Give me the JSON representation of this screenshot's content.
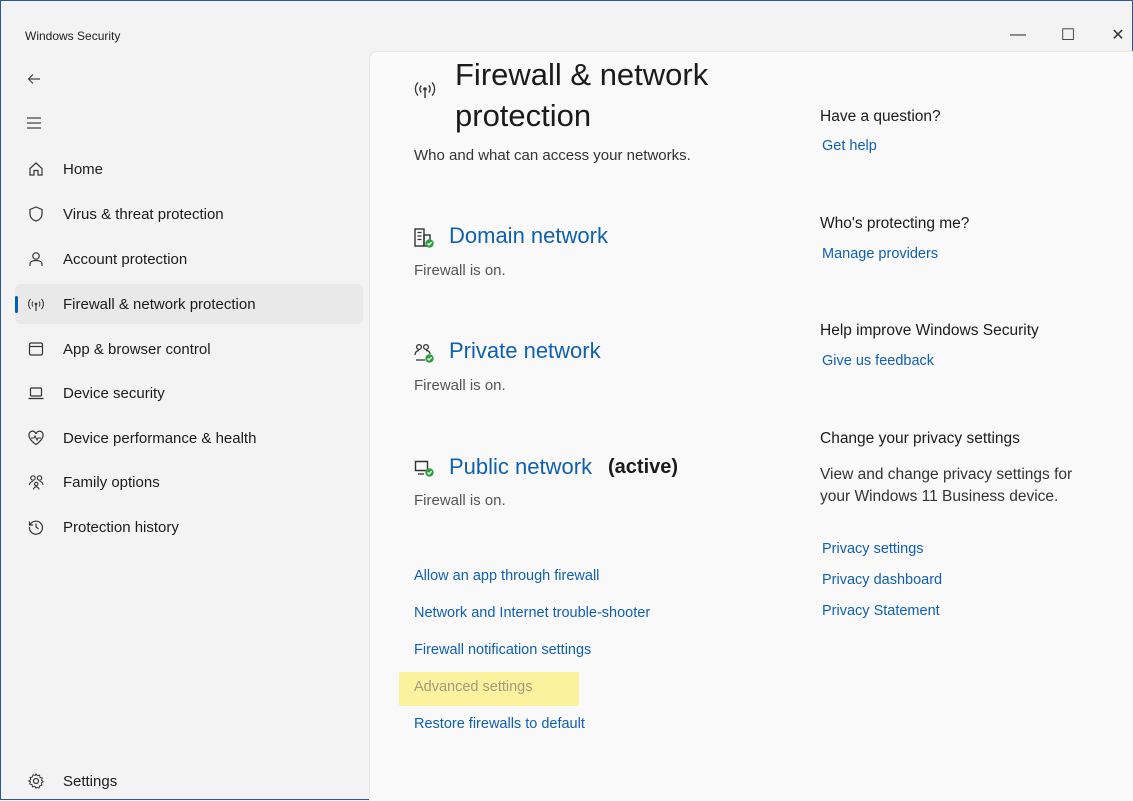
{
  "window": {
    "title": "Windows Security",
    "controls": {
      "minimize": "—",
      "maximize": "☐",
      "close": "✕"
    }
  },
  "sidebar": {
    "back_icon": "back-arrow-icon",
    "menu_icon": "hamburger-menu-icon",
    "items": [
      {
        "label": "Home",
        "icon": "home-icon"
      },
      {
        "label": "Virus & threat protection",
        "icon": "shield-icon"
      },
      {
        "label": "Account protection",
        "icon": "person-icon"
      },
      {
        "label": "Firewall & network protection",
        "icon": "wireless-icon",
        "active": true
      },
      {
        "label": "App & browser control",
        "icon": "app-window-icon"
      },
      {
        "label": "Device security",
        "icon": "laptop-icon"
      },
      {
        "label": "Device performance & health",
        "icon": "heart-pulse-icon"
      },
      {
        "label": "Family options",
        "icon": "family-icon"
      },
      {
        "label": "Protection history",
        "icon": "history-icon"
      }
    ],
    "settings": {
      "label": "Settings",
      "icon": "gear-icon"
    }
  },
  "main": {
    "title": "Firewall & network protection",
    "subtitle": "Who and what can access your networks.",
    "networks": [
      {
        "name": "Domain network",
        "status": "Firewall is on.",
        "active_label": "",
        "icon": "domain-network-icon"
      },
      {
        "name": "Private network",
        "status": "Firewall is on.",
        "active_label": "",
        "icon": "private-network-icon"
      },
      {
        "name": "Public network",
        "status": "Firewall is on.",
        "active_label": "(active)",
        "icon": "public-network-icon"
      }
    ],
    "links": [
      {
        "label": "Allow an app through firewall"
      },
      {
        "label": "Network and Internet trouble-shooter"
      },
      {
        "label": "Firewall notification settings"
      },
      {
        "label": "Advanced settings",
        "highlighted": true
      },
      {
        "label": "Restore firewalls to default"
      }
    ]
  },
  "aside": {
    "question": {
      "heading": "Have a question?",
      "link": "Get help"
    },
    "protecting": {
      "heading": "Who's protecting me?",
      "link": "Manage providers"
    },
    "improve": {
      "heading": "Help improve Windows Security",
      "link": "Give us feedback"
    },
    "privacy": {
      "heading": "Change your privacy settings",
      "text": "View and change privacy settings for your Windows 11 Business device.",
      "links": [
        "Privacy settings",
        "Privacy dashboard",
        "Privacy Statement"
      ]
    }
  },
  "colors": {
    "accent": "#005fb8",
    "link": "#1060b0",
    "highlight": "#fcf29e",
    "status_ok": "#2e9e3e"
  }
}
